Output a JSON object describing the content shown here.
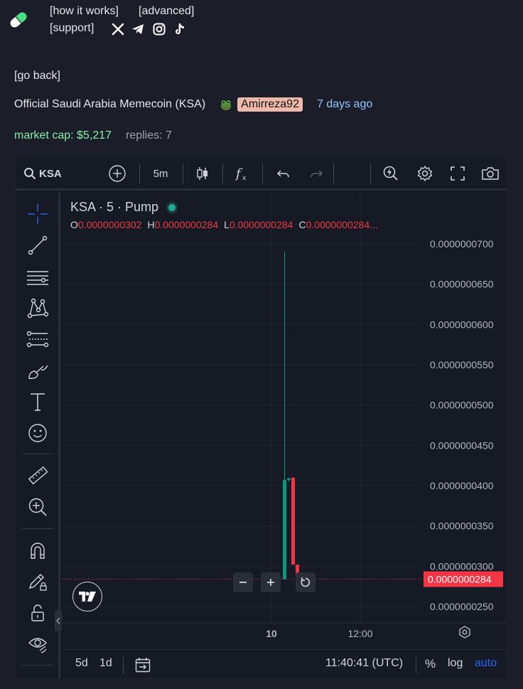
{
  "nav": {
    "how_it_works": "[how it works]",
    "advanced": "[advanced]",
    "support": "[support]",
    "socials": [
      "x-icon",
      "telegram-icon",
      "instagram-icon",
      "tiktok-icon"
    ]
  },
  "go_back": "[go back]",
  "token": {
    "name": "Official Saudi Arabia Memecoin (KSA)",
    "creator": "Amirreza92",
    "age": "7 days ago",
    "market_cap": "market cap: $5,217",
    "replies": "replies: 7"
  },
  "chart_toolbar": {
    "symbol": "KSA",
    "interval": "5m"
  },
  "legend": {
    "title": "KSA · 5 · Pump",
    "o_label": "O",
    "o": "0.0000000302",
    "h_label": "H",
    "h": "0.0000000284",
    "l_label": "L",
    "l": "0.0000000284",
    "c_label": "C",
    "c": "0.0000000284..."
  },
  "bottom_bar": {
    "range_5d": "5d",
    "range_1d": "1d",
    "clock": "11:40:41 (UTC)",
    "percent": "%",
    "log": "log",
    "auto": "auto"
  },
  "chart_data": {
    "type": "candlestick",
    "y_ticks": [
      "0.0000000700",
      "0.0000000650",
      "0.0000000600",
      "0.0000000550",
      "0.0000000500",
      "0.0000000450",
      "0.0000000400",
      "0.0000000350",
      "0.0000000300",
      "0.0000000250"
    ],
    "x_ticks": [
      "10",
      "12:00"
    ],
    "last_price": "0.0000000284",
    "ylim": [
      2.43e-08,
      7.22e-08
    ],
    "candles": [
      {
        "o": 2.84e-08,
        "h": 6.9e-08,
        "l": 2.84e-08,
        "c": 4.07e-08,
        "color": "up"
      },
      {
        "o": 4.07e-08,
        "h": 4.1e-08,
        "l": 4.05e-08,
        "c": 4.09e-08,
        "color": "up"
      },
      {
        "o": 4.1e-08,
        "h": 4.1e-08,
        "l": 3.02e-08,
        "c": 3.02e-08,
        "color": "down"
      },
      {
        "o": 3.02e-08,
        "h": 3.02e-08,
        "l": 2.84e-08,
        "c": 2.84e-08,
        "color": "down"
      }
    ],
    "colors": {
      "up": "#089981",
      "down": "#f23645",
      "grid": "#232632",
      "axis_text": "#b2b5be",
      "price_tag": "#f23645"
    }
  }
}
